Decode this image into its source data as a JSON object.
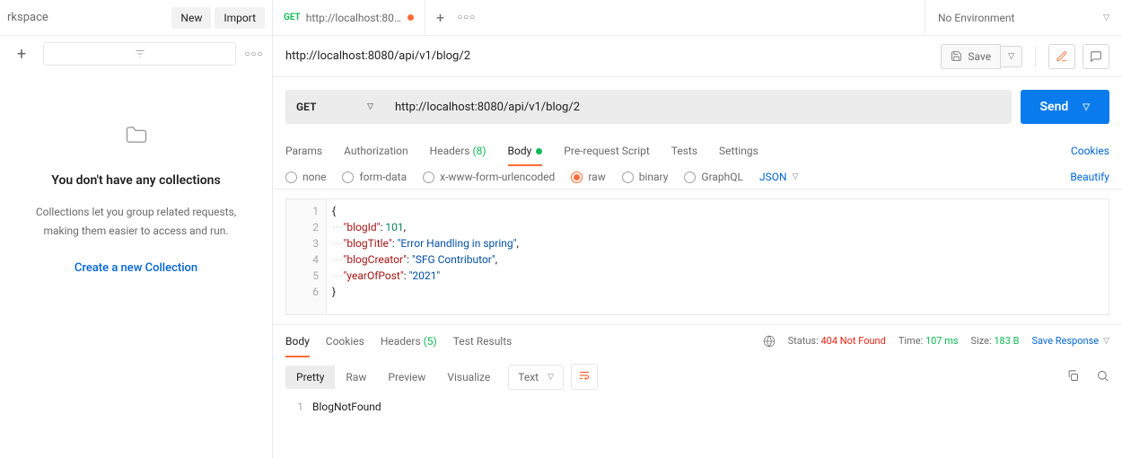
{
  "sidebar": {
    "workspace_label": "rkspace",
    "new_btn": "New",
    "import_btn": "Import",
    "empty_title": "You don't have any collections",
    "empty_desc": "Collections let you group related requests, making them easier to access and run.",
    "create_link": "Create a new Collection"
  },
  "tabs": {
    "active": {
      "method": "GET",
      "label": "http://localhost:80..."
    }
  },
  "env": {
    "label": "No Environment"
  },
  "request": {
    "title": "http://localhost:8080/api/v1/blog/2",
    "save_btn": "Save",
    "method": "GET",
    "url": "http://localhost:8080/api/v1/blog/2",
    "send_btn": "Send",
    "tabs": {
      "params": "Params",
      "auth": "Authorization",
      "headers": "Headers",
      "headers_count": "(8)",
      "body": "Body",
      "prereq": "Pre-request Script",
      "tests": "Tests",
      "settings": "Settings",
      "cookies": "Cookies"
    },
    "body_types": {
      "none": "none",
      "formdata": "form-data",
      "urlencoded": "x-www-form-urlencoded",
      "raw": "raw",
      "binary": "binary",
      "graphql": "GraphQL",
      "json": "JSON",
      "beautify": "Beautify"
    },
    "body_json": {
      "blogId": 101,
      "blogTitle": "Error Handling in spring",
      "blogCreator": "SFG Contributor",
      "yearOfPost": "2021"
    }
  },
  "response": {
    "tabs": {
      "body": "Body",
      "cookies": "Cookies",
      "headers": "Headers",
      "headers_count": "(5)",
      "tests": "Test Results"
    },
    "status_label": "Status:",
    "status_value": "404 Not Found",
    "time_label": "Time:",
    "time_value": "107 ms",
    "size_label": "Size:",
    "size_value": "183 B",
    "save_response": "Save Response",
    "view": {
      "pretty": "Pretty",
      "raw": "Raw",
      "preview": "Preview",
      "visualize": "Visualize",
      "text": "Text"
    },
    "body_text": "BlogNotFound"
  }
}
